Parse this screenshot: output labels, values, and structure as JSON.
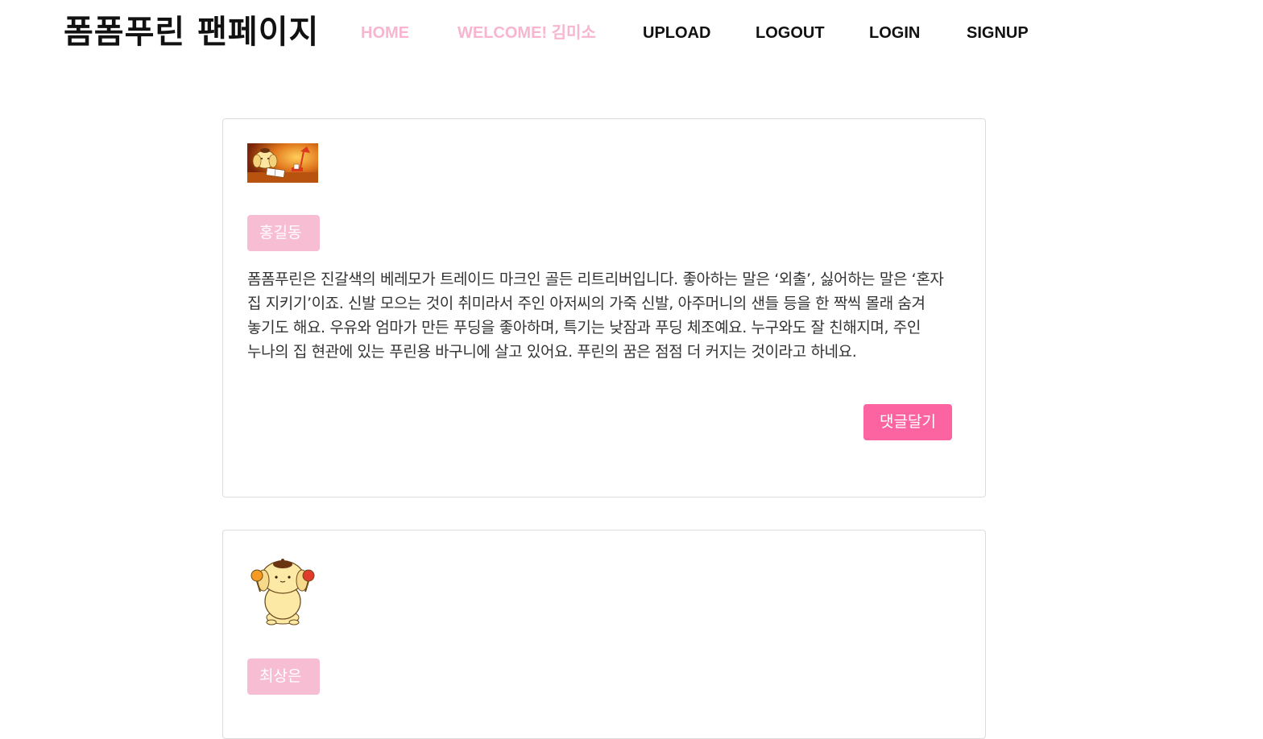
{
  "nav": {
    "brand": "폼폼푸린 팬페이지",
    "links": [
      "HOME",
      "WELCOME! 김미소",
      "UPLOAD",
      "LOGOUT",
      "LOGIN",
      "SIGNUP"
    ]
  },
  "posts": [
    {
      "author": "홍길동",
      "image": "pompompurin-reading-at-desk",
      "text": "폼폼푸린은 진갈색의 베레모가 트레이드 마크인 골든 리트리버입니다. 좋아하는 말은 ‘외출’, 싫어하는 말은 ‘혼자 집 지키기’이죠. 신발 모으는 것이 취미라서 주인 아저씨의 가죽 신발, 아주머니의 샌들 등을 한 짝씩 몰래 숨겨 놓기도 해요. 우유와 엄마가 만든 푸딩을 좋아하며, 특기는 낮잠과 푸딩 체조예요. 누구와도 잘 친해지며, 주인 누나의 집 현관에 있는 푸린용 바구니에 살고 있어요. 푸린의 꿈은 점점 더 커지는 것이라고 하네요.",
      "comment_label": "댓글달기"
    },
    {
      "author": "최상은",
      "image": "pompompurin-with-maracas"
    }
  ],
  "colors": {
    "nav_active": "#f7b5cf",
    "author_button": "#f7bed3",
    "comment_button": "#fb64a0"
  }
}
